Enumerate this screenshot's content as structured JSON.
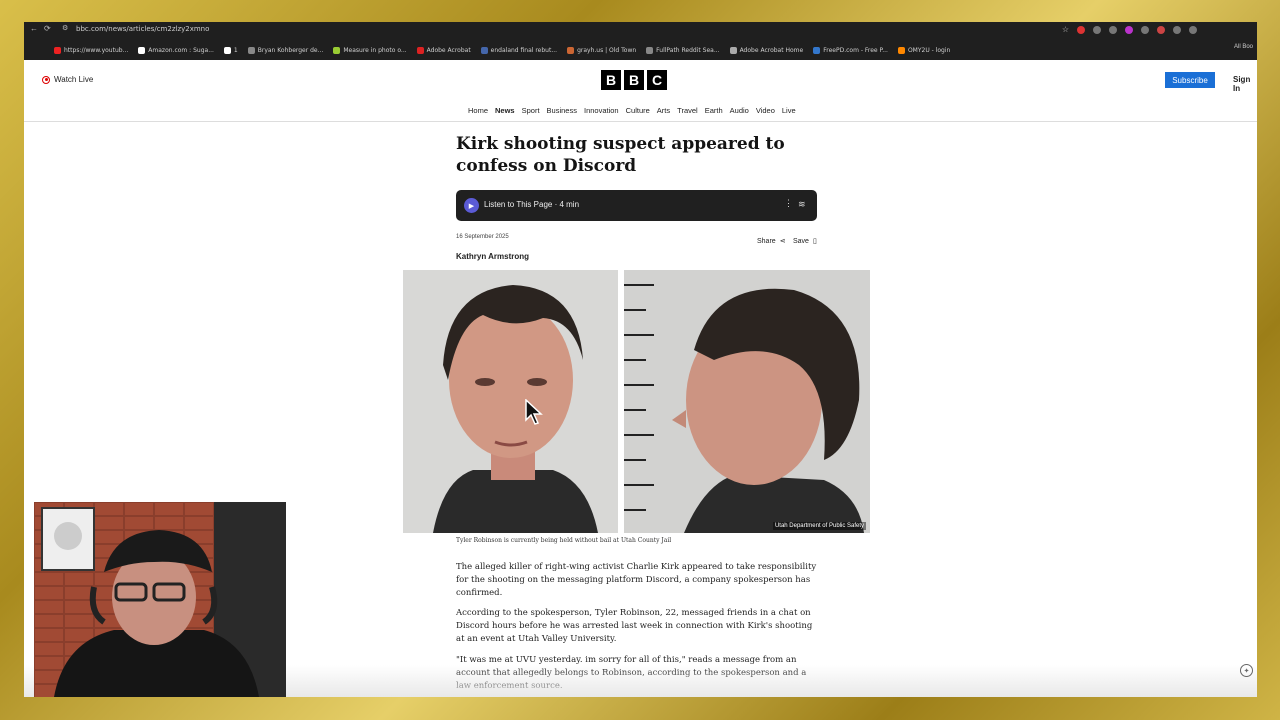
{
  "browser": {
    "url": "bbc.com/news/articles/cm2zlzy2xmno",
    "bookmarks": [
      "https://www.youtub...",
      "Amazon.com : Suga...",
      "1",
      "Bryan Kohberger de...",
      "Measure in photo o...",
      "Adobe Acrobat",
      "endaland final rebut...",
      "grayh.us | Old Town",
      "FullPath Reddit Sea...",
      "Adobe Acrobat Home",
      "FreePD.com - Free P...",
      "OMY2U - login"
    ],
    "all_bookmarks": "All Boo"
  },
  "header": {
    "watch_live": "Watch Live",
    "logo_letters": [
      "B",
      "B",
      "C"
    ],
    "subscribe": "Subscribe",
    "sign_in": "Sign In"
  },
  "nav": [
    "Home",
    "News",
    "Sport",
    "Business",
    "Innovation",
    "Culture",
    "Arts",
    "Travel",
    "Earth",
    "Audio",
    "Video",
    "Live"
  ],
  "article": {
    "headline": "Kirk shooting suspect appeared to confess on Discord",
    "player_label": "Listen to This Page · 4 min",
    "date": "16 September 2025",
    "share": "Share",
    "save": "Save",
    "author": "Kathryn Armstrong",
    "image_credit": "Utah Department of Public Safety",
    "caption": "Tyler Robinson is currently being held without bail at Utah County Jail",
    "paragraphs": [
      "The alleged killer of right-wing activist Charlie Kirk appeared to take responsibility for the shooting on the messaging platform Discord, a company spokesperson has confirmed.",
      "According to the spokesperson, Tyler Robinson, 22, messaged friends in a chat on Discord hours before he was arrested last week in connection with Kirk's shooting at an event at Utah Valley University.",
      "\"It was me at UVU yesterday. im sorry for all of this,\" reads a message from an account that allegedly belongs to Robinson, according to the spokesperson and a law enforcement source."
    ]
  },
  "colors": {
    "frame_gold": "#c9ad3c",
    "subscribe_blue": "#1a6fd6",
    "player_bg": "#202020",
    "play_purple": "#5b5bd6"
  }
}
